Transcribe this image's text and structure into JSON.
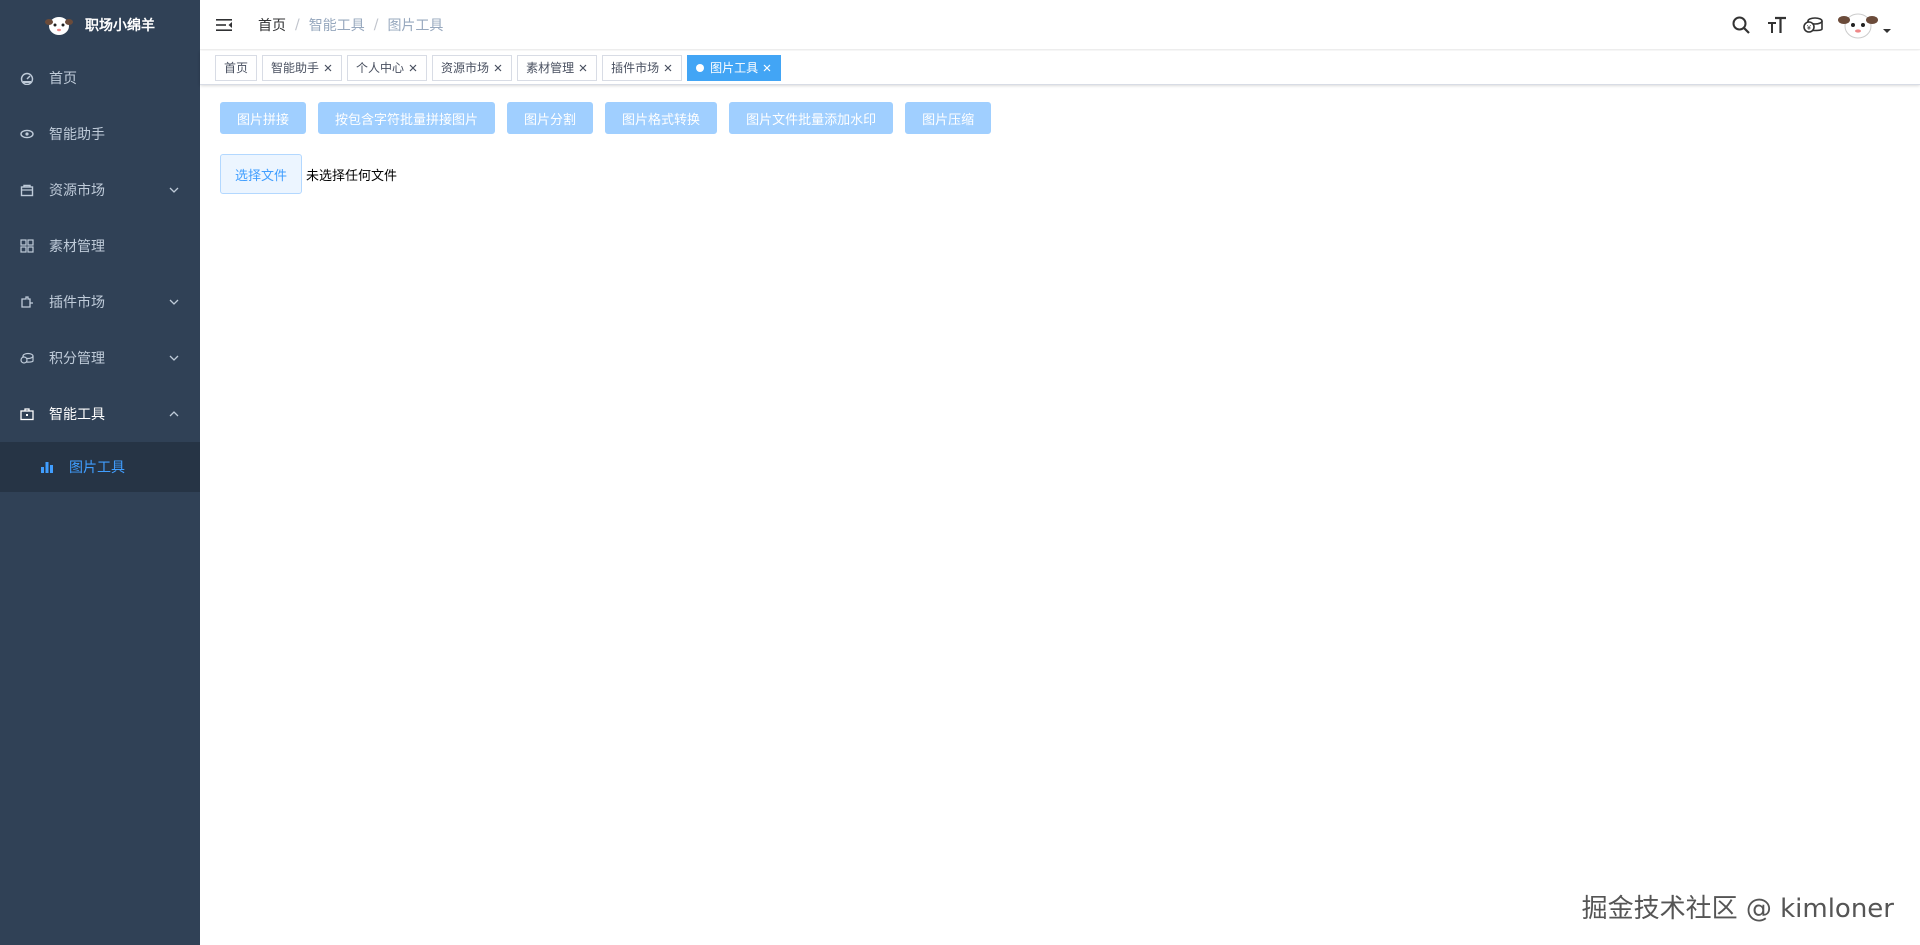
{
  "sidebar": {
    "brand_title": "职场小绵羊",
    "items": [
      {
        "label": "首页"
      },
      {
        "label": "智能助手"
      },
      {
        "label": "资源市场"
      },
      {
        "label": "素材管理"
      },
      {
        "label": "插件市场"
      },
      {
        "label": "积分管理"
      },
      {
        "label": "智能工具"
      }
    ],
    "subitem": {
      "label": "图片工具"
    },
    "bg_color": "#304156",
    "active_color": "#409eff"
  },
  "navbar": {
    "breadcrumb": [
      "首页",
      "智能工具",
      "图片工具"
    ]
  },
  "tags": [
    "首页",
    "智能助手",
    "个人中心",
    "资源市场",
    "素材管理",
    "插件市场",
    "图片工具"
  ],
  "toolbar": {
    "buttons": [
      "图片拼接",
      "按包含字符批量拼接图片",
      "图片分割",
      "图片格式转换",
      "图片文件批量添加水印",
      "图片压缩"
    ]
  },
  "file": {
    "button_label": "选择文件",
    "status": "未选择任何文件"
  },
  "watermark": "掘金技术社区 @ kimloner"
}
